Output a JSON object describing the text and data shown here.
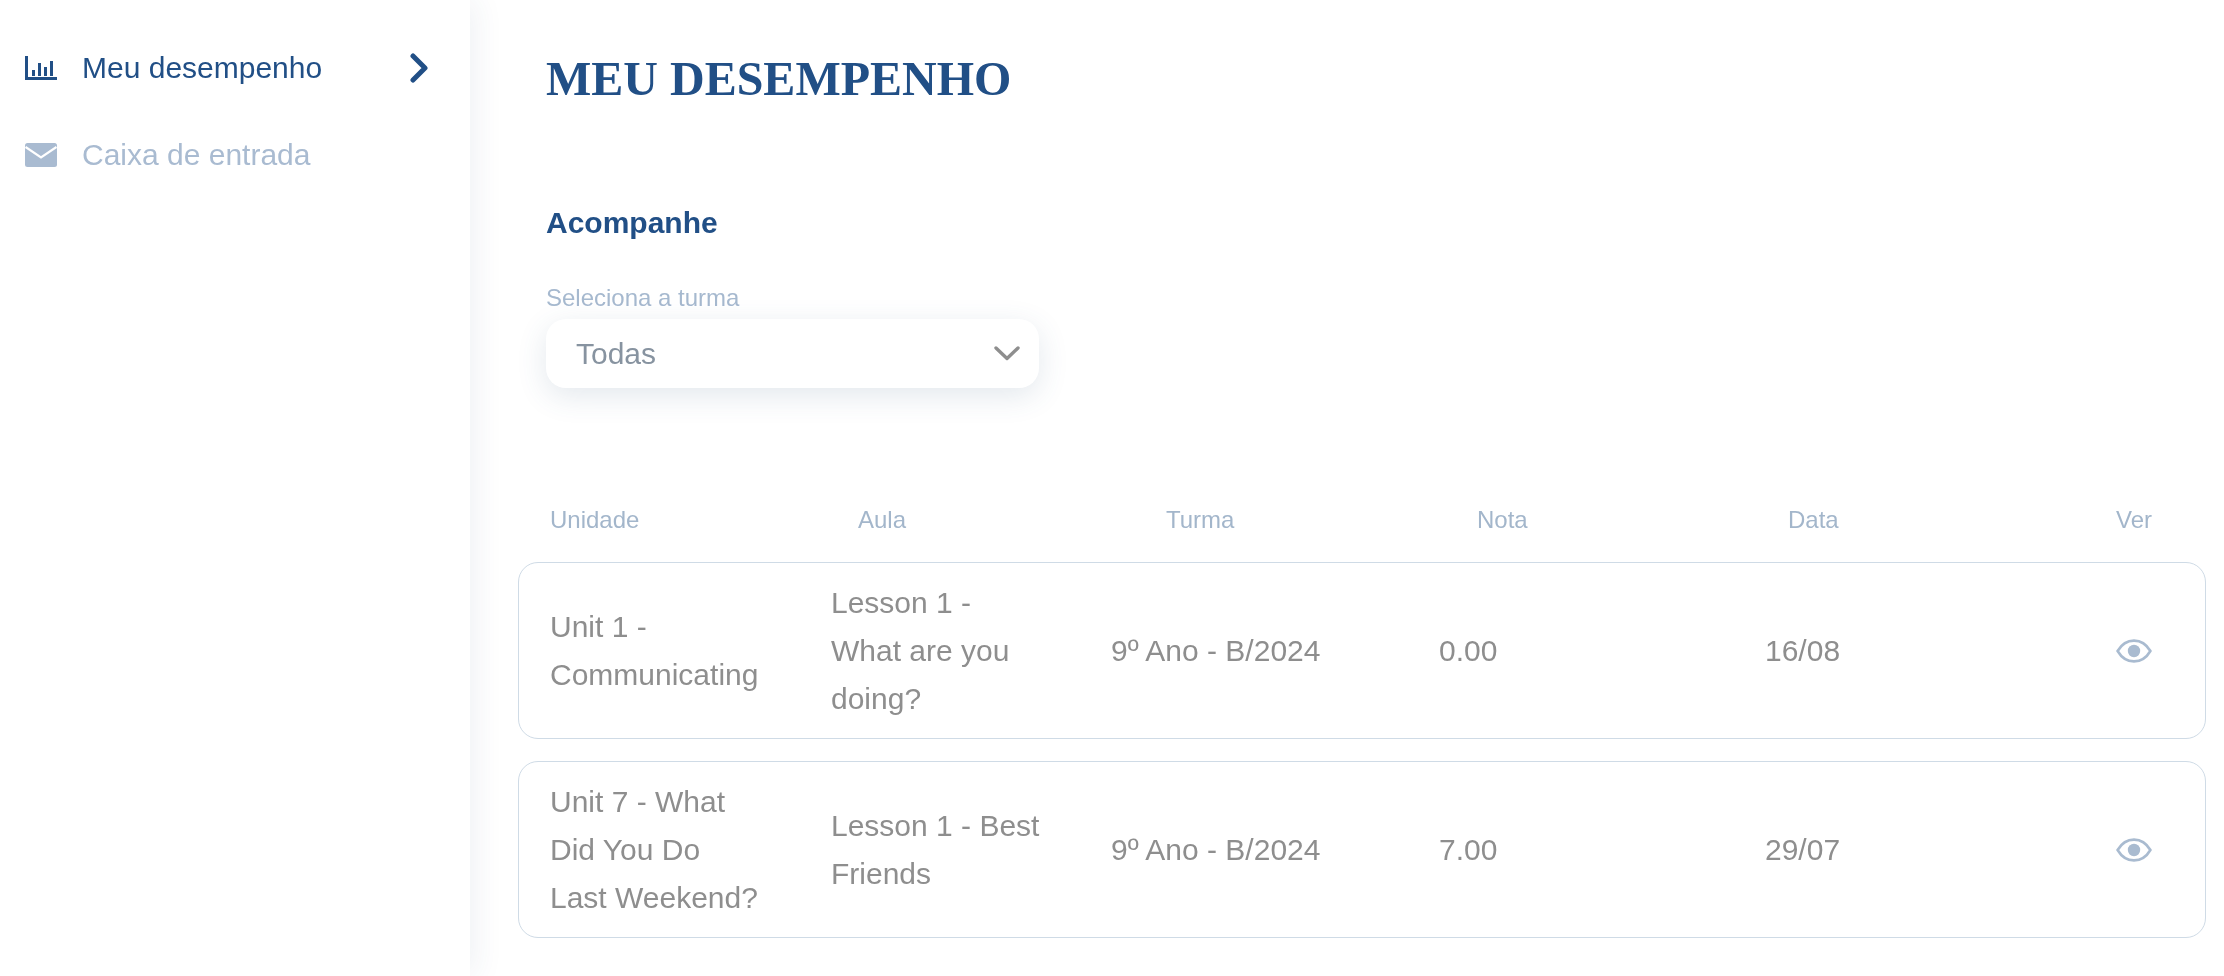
{
  "sidebar": {
    "items": [
      {
        "label": "Meu desempenho",
        "selected": true
      },
      {
        "label": "Caixa de entrada",
        "selected": false
      }
    ]
  },
  "page": {
    "title": "MEU DESEMPENHO"
  },
  "filter": {
    "heading": "Acompanhe",
    "label": "Seleciona a turma",
    "value": "Todas"
  },
  "table": {
    "columns": [
      "Unidade",
      "Aula",
      "Turma",
      "Nota",
      "Data",
      "Ver"
    ],
    "rows": [
      {
        "unit": "Unit 1 - Communicating",
        "lesson": "Lesson 1 - What are you doing?",
        "class": "9º Ano - B/2024",
        "grade": "0.00",
        "date": "16/08"
      },
      {
        "unit": "Unit 7 - What Did You Do Last Weekend?",
        "lesson": "Lesson 1 - Best Friends",
        "class": "9º Ano - B/2024",
        "grade": "7.00",
        "date": "29/07"
      }
    ]
  }
}
